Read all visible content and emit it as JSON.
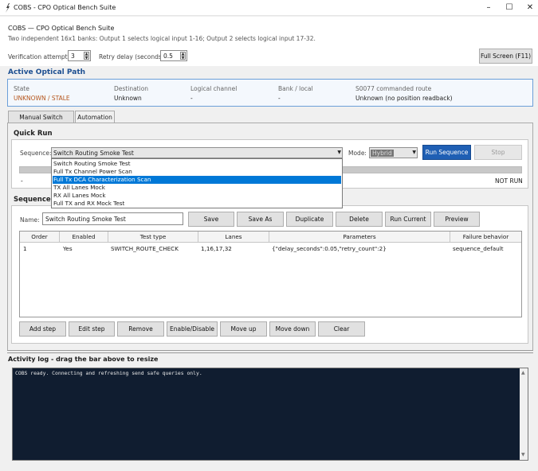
{
  "window": {
    "title": "COBS - CPO Optical Bench Suite",
    "minimize": "–",
    "maximize": "☐",
    "close": "✕"
  },
  "header": {
    "title": "COBS — CPO Optical Bench Suite",
    "subtitle": "Two independent 16x1 banks: Output 1 selects logical input 1-16; Output 2 selects logical input 17-32.",
    "verification_label": "Verification attempts:",
    "verification_value": "3",
    "retry_label": "Retry delay (seconds):",
    "retry_value": "0.5",
    "fullscreen_label": "Full Screen (F11)"
  },
  "active_path": {
    "title": "Active Optical Path",
    "columns": [
      {
        "header": "State",
        "value": "UNKNOWN / STALE"
      },
      {
        "header": "Destination",
        "value": "Unknown"
      },
      {
        "header": "Logical channel",
        "value": "-"
      },
      {
        "header": "Bank / local",
        "value": "-"
      },
      {
        "header": "S0077 commanded route",
        "value": "Unknown (no position readback)"
      }
    ],
    "state_color": "#b5541a"
  },
  "tabs": [
    {
      "label": "Manual Switch Control"
    },
    {
      "label": "Automation"
    }
  ],
  "quick_run": {
    "title": "Quick Run",
    "sequence_label": "Sequence:",
    "sequence_value": "Switch Routing Smoke Test",
    "mode_label": "Mode:",
    "mode_value": "Hybrid",
    "run_label": "Run Sequence",
    "stop_label": "Stop",
    "status_left": "-",
    "status_right": "NOT RUN",
    "dropdown_options": [
      "Switch Routing Smoke Test",
      "Full Tx Channel Power Scan",
      "Full Tx DCA Characterization Scan",
      "TX All Lanes Mock",
      "RX All Lanes Mock",
      "Full TX and RX Mock Test"
    ],
    "highlighted_index": 2
  },
  "sequence_builder": {
    "title": "Sequence Bu",
    "name_label": "Name:",
    "name_value": "Switch Routing Smoke Test",
    "buttons": [
      "Save",
      "Save As",
      "Duplicate",
      "Delete",
      "Run Current",
      "Preview"
    ],
    "columns": [
      "Order",
      "Enabled",
      "Test type",
      "Lanes",
      "Parameters",
      "Failure behavior"
    ],
    "rows": [
      [
        "1",
        "Yes",
        "SWITCH_ROUTE_CHECK",
        "1,16,17,32",
        "{\"delay_seconds\":0.05,\"retry_count\":2}",
        "sequence_default"
      ]
    ],
    "step_buttons": [
      "Add step",
      "Edit step",
      "Remove",
      "Enable/Disable",
      "Move up",
      "Move down",
      "Clear"
    ]
  },
  "log": {
    "title": "Activity log - drag the bar above to resize",
    "text": "COBS ready. Connecting and refreshing send safe queries only.",
    "up_arrow": "▲",
    "down_arrow": "▼"
  },
  "colors": {
    "accent": "#1f5fb4",
    "section_title": "#1d4f91",
    "log_bg": "#101d30"
  },
  "icons": [
    "app-icon",
    "spin-arrows-icon",
    "dropdown-arrow-icon"
  ]
}
